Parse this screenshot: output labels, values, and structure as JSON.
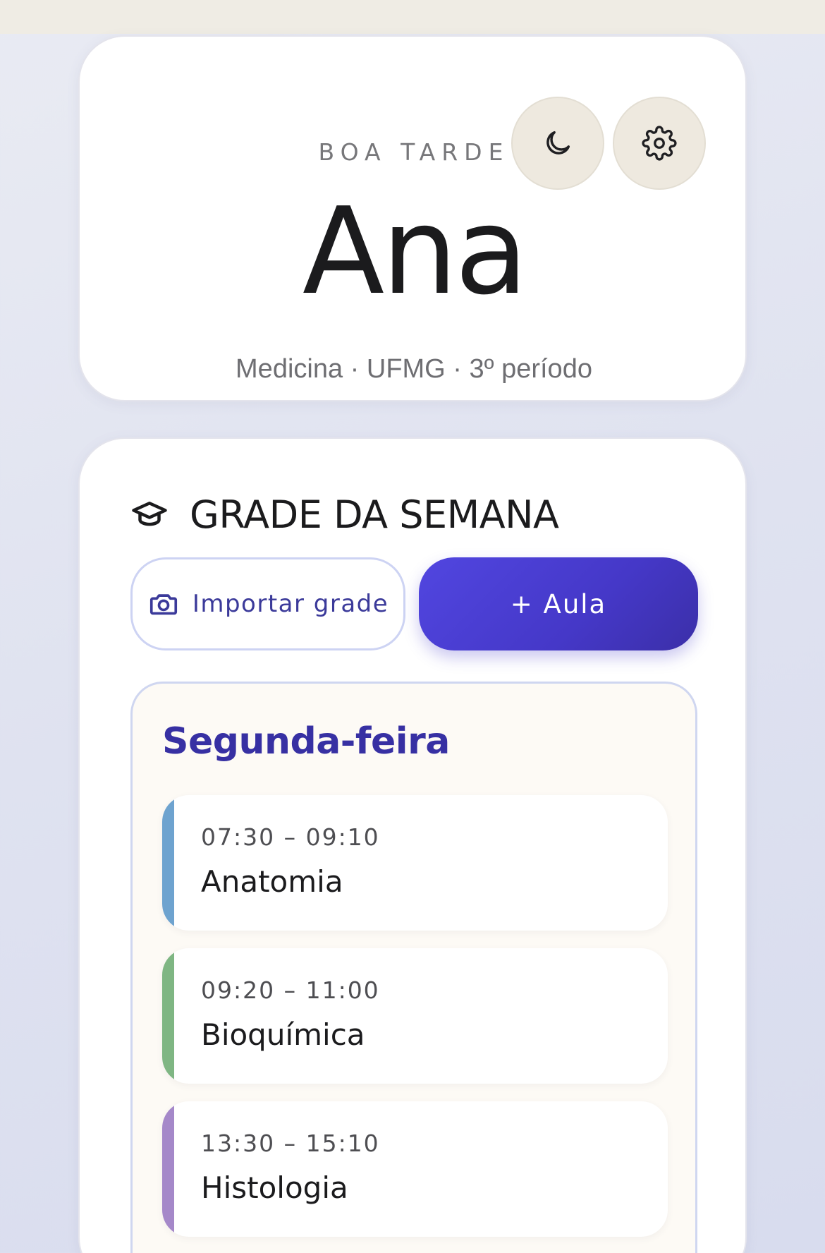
{
  "header": {
    "greeting": "BOA TARDE",
    "name": "Ana",
    "subtitle": "Medicina · UFMG · 3º período"
  },
  "actions": {
    "theme_icon": "moon-icon",
    "settings_icon": "gear-icon"
  },
  "schedule": {
    "title": "GRADE DA SEMANA",
    "title_icon": "graduation-cap-icon",
    "import_label": "Importar grade",
    "import_icon": "camera-icon",
    "add_label": "+ Aula",
    "day": {
      "name": "Segunda-feira",
      "classes": [
        {
          "time": "07:30 – 09:10",
          "subject": "Anatomia",
          "color": "#6ea3cf"
        },
        {
          "time": "09:20 – 11:00",
          "subject": "Bioquímica",
          "color": "#7fb683"
        },
        {
          "time": "13:30 – 15:10",
          "subject": "Histologia",
          "color": "#a588c9"
        }
      ]
    }
  },
  "colors": {
    "accent": "#4538c8",
    "day_title": "#3730a3"
  }
}
